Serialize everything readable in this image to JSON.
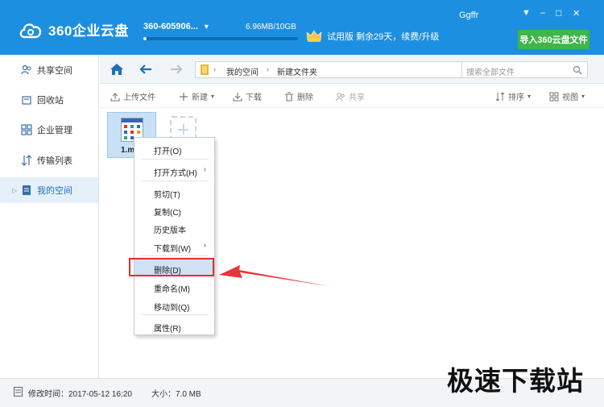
{
  "app": {
    "name": "360企业云盘",
    "account": "360-605906...",
    "quota_text": "6.96MB/10GB",
    "quota_fraction": 0.01,
    "vip_text": "试用版 剩余29天，续费/升级",
    "user": "Ggffr",
    "import_button": "导入360云盘文件",
    "colors": {
      "title_bar": "#1d8fe0",
      "import_button": "#3fb54a",
      "highlight": "#e02e2e",
      "arrow": "#e8373a"
    }
  },
  "window_controls": {
    "menu": "▼",
    "minimize": "–",
    "maximize": "□",
    "close": "✕"
  },
  "sidebar": {
    "items": [
      {
        "label": "共享空间",
        "icon": "users-icon"
      },
      {
        "label": "回收站",
        "icon": "trash-icon"
      },
      {
        "label": "企业管理",
        "icon": "grid-icon"
      },
      {
        "label": "传输列表",
        "icon": "transfer-icon"
      },
      {
        "label": "我的空间",
        "icon": "doc-icon",
        "active": true
      }
    ]
  },
  "nav": {
    "path": [
      "我的空间",
      "新建文件夹"
    ],
    "search_placeholder": "搜索全部文件"
  },
  "toolbar": {
    "upload": "上传文件",
    "new": "新建",
    "download": "下载",
    "delete": "删除",
    "share": "共享",
    "sort": "排序",
    "view": "视图"
  },
  "file": {
    "name": "1.m"
  },
  "context_menu": {
    "open": "打开(O)",
    "open_with": "打开方式(H)",
    "cut": "剪切(T)",
    "copy": "复制(C)",
    "history": "历史版本",
    "download_to": "下载到(W)",
    "delete": "删除(D)",
    "rename": "重命名(M)",
    "move_to": "移动到(Q)",
    "properties": "属性(R)"
  },
  "status": {
    "modified": "修改时间：2017-05-12 16:20",
    "size": "大小：7.0 MB"
  },
  "watermark": "极速下载站"
}
